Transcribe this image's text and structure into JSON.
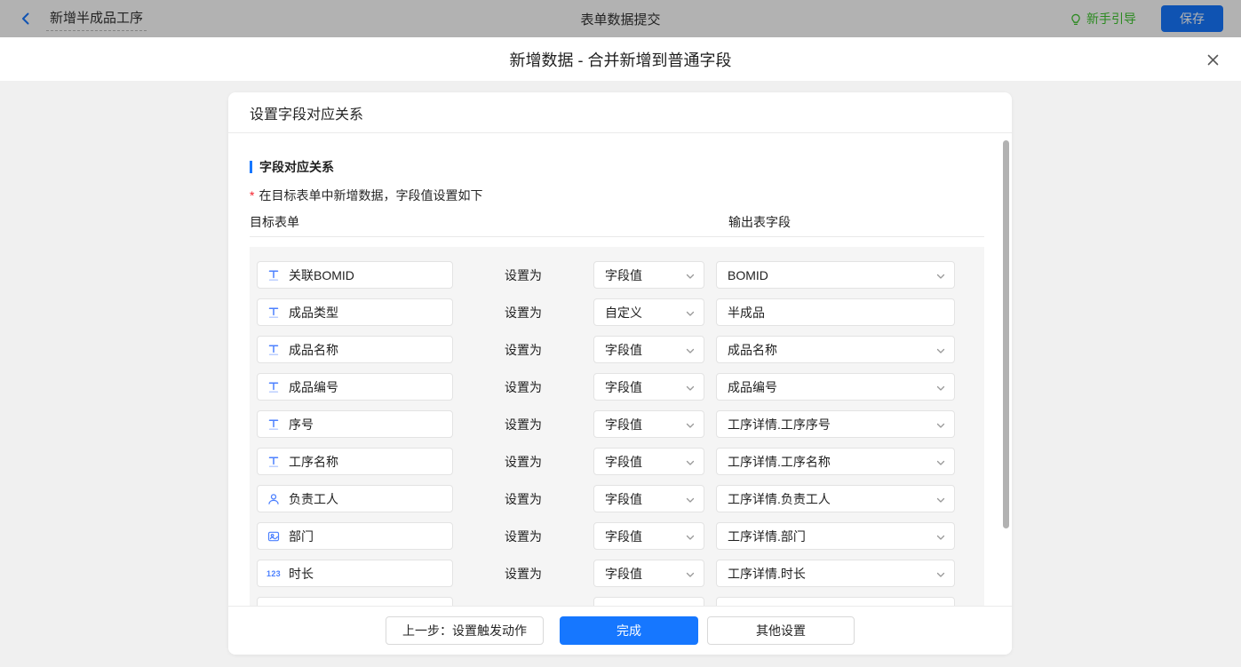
{
  "colors": {
    "accent": "#1677ff",
    "guide_green": "#3ec62e",
    "required_red": "#f5222d",
    "field_icon_blue": "#4c80ff"
  },
  "topbar": {
    "back_title": "新增半成品工序",
    "center_title": "表单数据提交",
    "guide_label": "新手引导",
    "save_label": "保存"
  },
  "dialog": {
    "title": "新增数据 - 合并新增到普通字段",
    "close_icon": "close-icon",
    "card_title": "设置字段对应关系",
    "section_title": "字段对应关系",
    "section_desc": "在目标表单中新增数据，字段值设置如下",
    "required_mark": "*",
    "columns": {
      "left": "目标表单",
      "right": "输出表字段"
    },
    "set_as_label": "设置为",
    "rows": [
      {
        "icon": "text-field-icon",
        "field": "关联BOMID",
        "mode": "字段值",
        "value": "BOMID",
        "value_type": "select"
      },
      {
        "icon": "text-field-icon",
        "field": "成品类型",
        "mode": "自定义",
        "value": "半成品",
        "value_type": "input"
      },
      {
        "icon": "text-field-icon",
        "field": "成品名称",
        "mode": "字段值",
        "value": "成品名称",
        "value_type": "select"
      },
      {
        "icon": "text-field-icon",
        "field": "成品编号",
        "mode": "字段值",
        "value": "成品编号",
        "value_type": "select"
      },
      {
        "icon": "text-field-icon",
        "field": "序号",
        "mode": "字段值",
        "value": "工序详情.工序序号",
        "value_type": "select"
      },
      {
        "icon": "text-field-icon",
        "field": "工序名称",
        "mode": "字段值",
        "value": "工序详情.工序名称",
        "value_type": "select"
      },
      {
        "icon": "member-icon",
        "field": "负责工人",
        "mode": "字段值",
        "value": "工序详情.负责工人",
        "value_type": "select"
      },
      {
        "icon": "department-icon",
        "field": "部门",
        "mode": "字段值",
        "value": "工序详情.部门",
        "value_type": "select"
      },
      {
        "icon": "number-icon",
        "field": "时长",
        "mode": "字段值",
        "value": "工序详情.时长",
        "value_type": "select"
      },
      {
        "icon": "",
        "field": "",
        "mode": "",
        "value": "",
        "value_type": "select",
        "partial": true
      }
    ],
    "footer": {
      "prev_label": "上一步：设置触发动作",
      "done_label": "完成",
      "other_label": "其他设置"
    }
  }
}
